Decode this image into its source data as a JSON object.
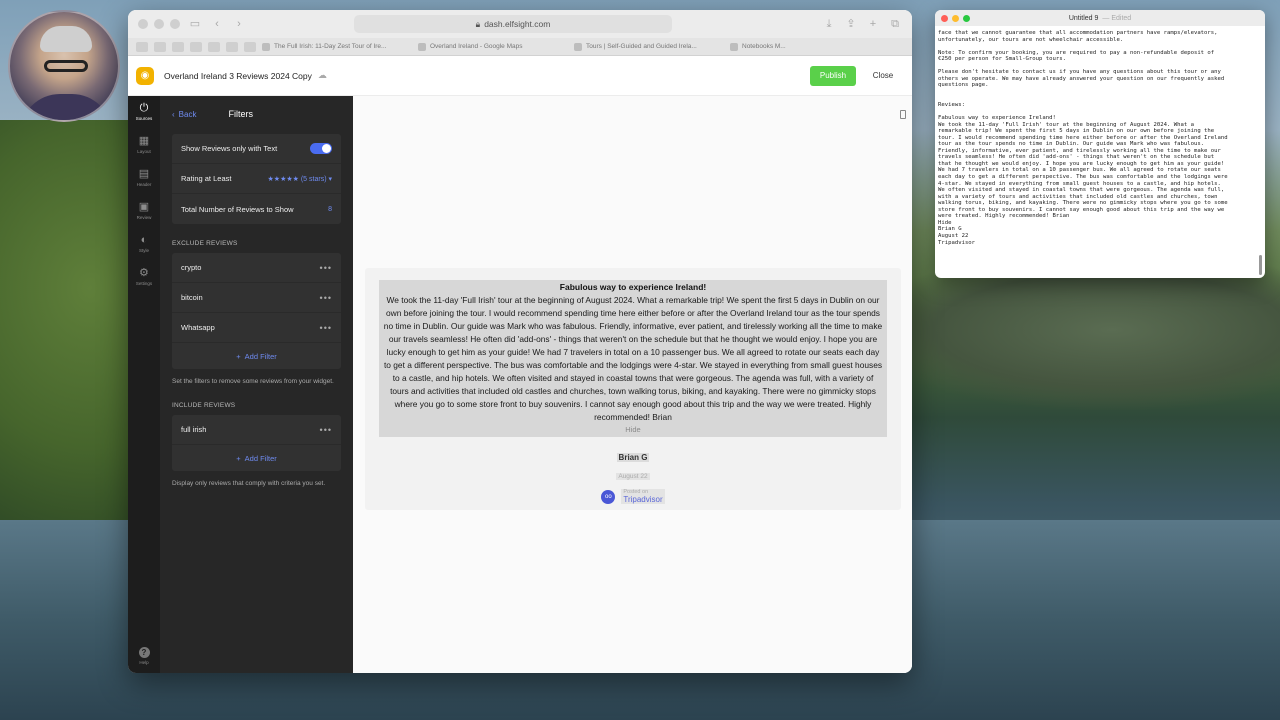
{
  "browser": {
    "url": "dash.elfsight.com",
    "tabs": [
      "The Full Irish: 11-Day Zest Tour of Ire...",
      "Overland Ireland - Google Maps",
      "Tours | Self-Guided and Guided Irela...",
      "Notebooks M..."
    ]
  },
  "app": {
    "title": "Overland Ireland 3 Reviews 2024 Copy",
    "publish_label": "Publish",
    "close_label": "Close",
    "brand_color": "#f2b200",
    "publish_color": "#5ad04a"
  },
  "rail": {
    "items": [
      {
        "label": "Sources",
        "icon": "plug-icon"
      },
      {
        "label": "Layout",
        "icon": "layout-icon"
      },
      {
        "label": "Header",
        "icon": "header-icon"
      },
      {
        "label": "Review",
        "icon": "review-icon"
      },
      {
        "label": "Style",
        "icon": "palette-icon"
      },
      {
        "label": "Settings",
        "icon": "gear-icon"
      }
    ],
    "help_label": "Help"
  },
  "filters": {
    "back_label": "Back",
    "title": "Filters",
    "show_text_label": "Show Reviews only with Text",
    "rating_label": "Rating at Least",
    "rating_value": "★★★★★ (5 stars)",
    "total_label": "Total Number of Reviews to Show",
    "total_value": "8",
    "exclude_heading": "EXCLUDE REVIEWS",
    "exclude_items": [
      "crypto",
      "bitcoin",
      "Whatsapp"
    ],
    "add_filter_label": "Add Filter",
    "exclude_hint": "Set the filters to remove some reviews from your widget.",
    "include_heading": "INCLUDE REVIEWS",
    "include_items": [
      "full irish"
    ],
    "include_hint": "Display only reviews that comply with criteria you set."
  },
  "review": {
    "title": "Fabulous way to experience Ireland!",
    "body": "We took the 11-day 'Full Irish' tour at the beginning of August 2024. What a remarkable trip! We spent the first 5 days in Dublin on our own before joining the tour. I would recommend spending time here either before or after the Overland Ireland tour as the tour spends no time in Dublin. Our guide was Mark who was fabulous. Friendly, informative, ever patient, and tirelessly working all the time to make our travels seamless! He often did 'add-ons' - things that weren't on the schedule but that he thought we would enjoy. I hope you are lucky enough to get him as your guide! We had 7 travelers in total on a 10 passenger bus. We all agreed to rotate our seats each day to get a different perspective. The bus was comfortable and the lodgings were 4-star. We stayed in everything from small guest houses to a castle, and hip hotels. We often visited and stayed in coastal towns that were gorgeous. The agenda was full, with a variety of tours and activities that included old castles and churches, town walking torus, biking, and kayaking. There were no gimmicky stops where you go to some store front to buy souvenirs. I cannot say enough good about this trip and the way we were treated. Highly recommended! Brian",
    "hide_label": "Hide",
    "author": "Brian G",
    "date": "August 22",
    "posted_on": "Posted on",
    "source": "Tripadvisor"
  },
  "notes": {
    "title": "Untitled 9",
    "edited": "— Edited",
    "text": "face that we cannot guarantee that all accommodation partners have ramps/elevators,\nunfortunately, our tours are not wheelchair accessible.\n\nNote: To confirm your booking, you are required to pay a non-refundable deposit of\n€250 per person for Small-Group tours.\n\nPlease don't hesitate to contact us if you have any questions about this tour or any\nothers we operate. We may have already answered your question on our frequently asked\nquestions page.\n\n\nReviews:\n\nFabulous way to experience Ireland!\nWe took the 11-day 'Full Irish' tour at the beginning of August 2024. What a\nremarkable trip! We spent the first 5 days in Dublin on our own before joining the\ntour. I would recommend spending time here either before or after the Overland Ireland\ntour as the tour spends no time in Dublin. Our guide was Mark who was fabulous.\nFriendly, informative, ever patient, and tirelessly working all the time to make our\ntravels seamless! He often did 'add-ons' - things that weren't on the schedule but\nthat he thought we would enjoy. I hope you are lucky enough to get him as your guide!\nWe had 7 travelers in total on a 10 passenger bus. We all agreed to rotate our seats\neach day to get a different perspective. The bus was comfortable and the lodgings were\n4-star. We stayed in everything from small guest houses to a castle, and hip hotels.\nWe often visited and stayed in coastal towns that were gorgeous. The agenda was full,\nwith a variety of tours and activities that included old castles and churches, town\nwalking torus, biking, and kayaking. There were no gimmicky stops where you go to some\nstore front to buy souvenirs. I cannot say enough good about this trip and the way we\nwere treated. Highly recommended! Brian\nHide\nBrian G\nAugust 22\nTripadvisor"
  }
}
